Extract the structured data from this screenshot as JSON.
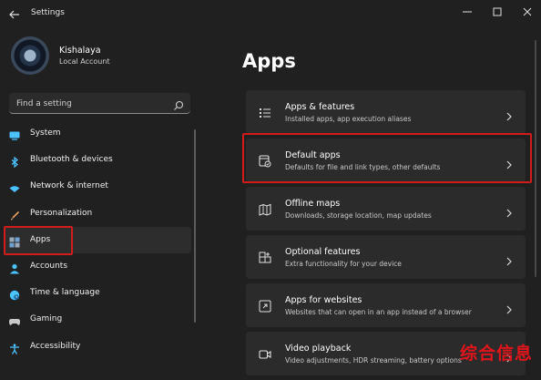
{
  "window": {
    "title": "Settings"
  },
  "profile": {
    "name": "Kishalaya",
    "account_type": "Local Account"
  },
  "search": {
    "placeholder": "Find a setting"
  },
  "nav": {
    "items": [
      {
        "label": "System",
        "icon": "monitor-icon"
      },
      {
        "label": "Bluetooth & devices",
        "icon": "bluetooth-icon"
      },
      {
        "label": "Network & internet",
        "icon": "wifi-icon"
      },
      {
        "label": "Personalization",
        "icon": "brush-icon"
      },
      {
        "label": "Apps",
        "icon": "apps-icon",
        "selected": true
      },
      {
        "label": "Accounts",
        "icon": "person-icon"
      },
      {
        "label": "Time & language",
        "icon": "globe-clock-icon"
      },
      {
        "label": "Gaming",
        "icon": "gamepad-icon"
      },
      {
        "label": "Accessibility",
        "icon": "accessibility-icon"
      }
    ]
  },
  "main": {
    "title": "Apps",
    "cards": [
      {
        "title": "Apps & features",
        "subtitle": "Installed apps, app execution aliases",
        "icon": "list-icon"
      },
      {
        "title": "Default apps",
        "subtitle": "Defaults for file and link types, other defaults",
        "icon": "default-apps-icon",
        "highlighted": true
      },
      {
        "title": "Offline maps",
        "subtitle": "Downloads, storage location, map updates",
        "icon": "map-icon"
      },
      {
        "title": "Optional features",
        "subtitle": "Extra functionality for your device",
        "icon": "optional-features-icon"
      },
      {
        "title": "Apps for websites",
        "subtitle": "Websites that can open in an app instead of a browser",
        "icon": "open-in-app-icon"
      },
      {
        "title": "Video playback",
        "subtitle": "Video adjustments, HDR streaming, battery options",
        "icon": "video-icon"
      }
    ]
  },
  "watermark": {
    "text": "综合信息"
  },
  "colors": {
    "background": "#202020",
    "card": "#2b2b2b",
    "highlight": "#d11c1c",
    "accent": "#4cc2ff"
  }
}
